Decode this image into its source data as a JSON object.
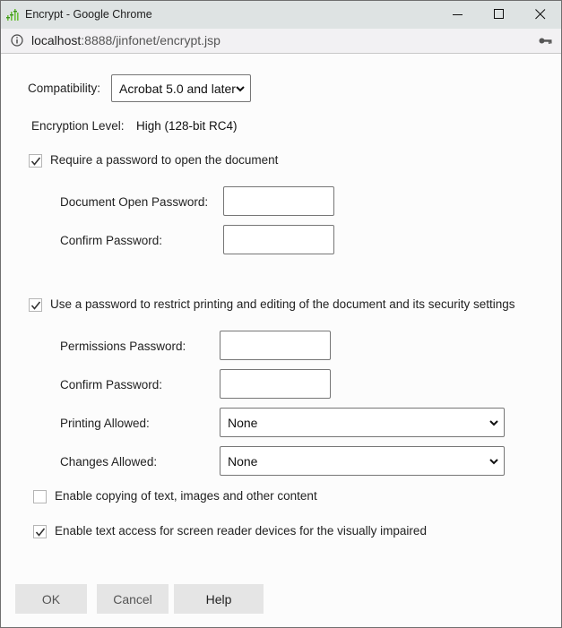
{
  "window": {
    "title": "Encrypt - Google Chrome",
    "url_host": "localhost",
    "url_rest": ":8888/jinfonet/encrypt.jsp",
    "controls": {
      "minimize": "minimize",
      "maximize": "maximize",
      "close": "close"
    }
  },
  "form": {
    "compatibility": {
      "label": "Compatibility:",
      "value": "Acrobat 5.0 and later"
    },
    "encryption_level": {
      "label": "Encryption Level:",
      "value": "High (128-bit RC4)"
    },
    "require_open_password": {
      "label": "Require a password to open the document",
      "checked": true,
      "open_password": {
        "label": "Document Open Password:",
        "value": ""
      },
      "confirm_password": {
        "label": "Confirm Password:",
        "value": ""
      }
    },
    "restrict_permissions": {
      "label": "Use a password to restrict printing and editing of the document and its security settings",
      "checked": true,
      "permissions_password": {
        "label": "Permissions Password:",
        "value": ""
      },
      "confirm_password": {
        "label": "Confirm Password:",
        "value": ""
      },
      "printing_allowed": {
        "label": "Printing Allowed:",
        "value": "None"
      },
      "changes_allowed": {
        "label": "Changes Allowed:",
        "value": "None"
      }
    },
    "enable_copying": {
      "label": "Enable copying of text, images and other content",
      "checked": false
    },
    "enable_screen_reader": {
      "label": "Enable text access for screen reader devices for the visually impaired",
      "checked": true
    }
  },
  "buttons": {
    "ok": "OK",
    "cancel": "Cancel",
    "help": "Help"
  },
  "colors": {
    "titlebar": "#dee3e3",
    "app_icon_green": "#6cbf3a",
    "button_bg": "#e5e5e5"
  }
}
